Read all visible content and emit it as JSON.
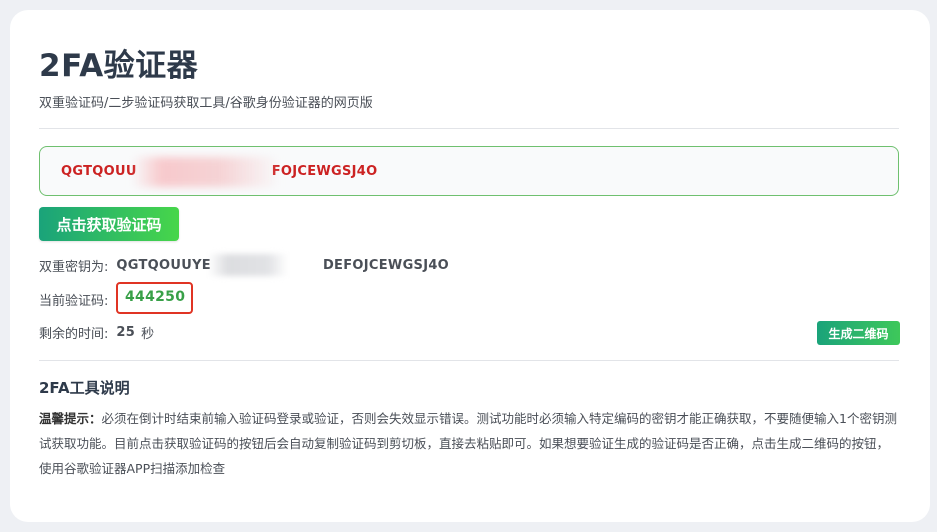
{
  "header": {
    "title": "2FA验证器",
    "subtitle": "双重验证码/二步验证码获取工具/谷歌身份验证器的网页版"
  },
  "secret_input": {
    "value_start": "QGTQOUU",
    "value_end": "FOJCEWGSJ4O"
  },
  "get_code_button": {
    "label": "点击获取验证码"
  },
  "secret_row": {
    "label": "双重密钥为:",
    "value_start": "QGTQOUUYE",
    "value_end": "DEFOJCEWGSJ4O"
  },
  "code_row": {
    "label": "当前验证码:",
    "value": "444250"
  },
  "time_row": {
    "label": "剩余的时间:",
    "value": "25",
    "unit": "秒"
  },
  "qr_button": {
    "label": "生成二维码"
  },
  "instructions": {
    "title": "2FA工具说明",
    "tip_label": "温馨提示：",
    "tip_text": "必须在倒计时结束前输入验证码登录或验证，否则会失效显示错误。测试功能时必须输入特定编码的密钥才能正确获取，不要随便输入1个密钥测试获取功能。目前点击获取验证码的按钮后会自动复制验证码到剪切板，直接去粘贴即可。如果想要验证生成的验证码是否正确，点击生成二维码的按钮，使用谷歌验证器APP扫描添加检查"
  },
  "colors": {
    "accent_green": "#38a048",
    "error_red": "#cc2222",
    "highlight_red": "#e03424"
  }
}
